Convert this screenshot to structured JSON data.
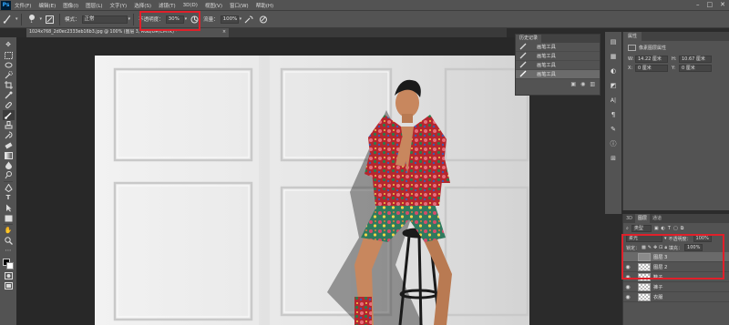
{
  "app": {
    "logo": "Ps"
  },
  "menu": [
    "文件(F)",
    "编辑(E)",
    "图像(I)",
    "图层(L)",
    "文字(Y)",
    "选择(S)",
    "滤镜(T)",
    "3D(D)",
    "视图(V)",
    "窗口(W)",
    "帮助(H)"
  ],
  "window_controls": {
    "minimize": "–",
    "maximize": "□",
    "close": "✕"
  },
  "options": {
    "brush_size": "1",
    "mode_label": "模式：",
    "mode_value": "正常",
    "opacity_label": "不透明度：",
    "opacity_value": "30%",
    "flow_label": "流量：",
    "flow_value": "100%"
  },
  "document": {
    "tab_title": "1024x768_2d0ec2333eb16b3.jpg @ 100% (图层 3, RGB/8#/CMYK) *",
    "close": "×"
  },
  "history": {
    "tab": "历史记录",
    "items": [
      {
        "label": "画笔工具",
        "selected": false
      },
      {
        "label": "画笔工具",
        "selected": false
      },
      {
        "label": "画笔工具",
        "selected": false
      },
      {
        "label": "画笔工具",
        "selected": true
      }
    ]
  },
  "properties": {
    "tab": "属性",
    "subtitle": "像素图层属性",
    "w_label": "W:",
    "w_value": "14.22 厘米",
    "h_label": "H:",
    "h_value": "10.67 厘米",
    "x_label": "X:",
    "x_value": "0 厘米",
    "y_label": "Y:",
    "y_value": "0 厘米"
  },
  "layers": {
    "tabs": [
      "3D",
      "图层",
      "通道"
    ],
    "filter_label": "类型",
    "blend_mode": "柔光",
    "opacity_label": "不透明度：",
    "opacity_value": "100%",
    "lock_label": "锁定：",
    "fill_label": "填充：",
    "fill_value": "100%",
    "items": [
      {
        "name": "图层 3",
        "selected": true,
        "visible": false
      },
      {
        "name": "图层 2",
        "selected": false,
        "visible": true
      },
      {
        "name": "鞋子",
        "selected": false,
        "visible": true
      },
      {
        "name": "裤子",
        "selected": false,
        "visible": true
      },
      {
        "name": "衣服",
        "selected": false,
        "visible": true
      }
    ]
  },
  "colors": {
    "ui_dark": "#535353",
    "canvas_bg": "#282828",
    "annotation": "#e0202a",
    "foreground": "#000000",
    "background": "#ffffff"
  }
}
